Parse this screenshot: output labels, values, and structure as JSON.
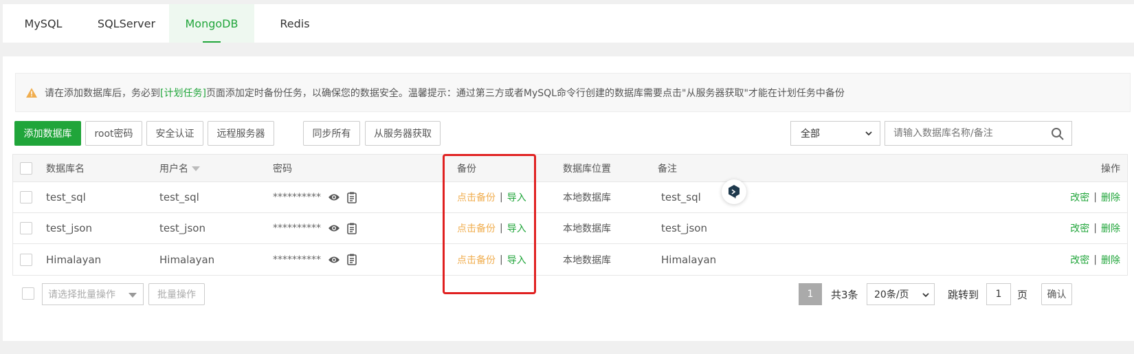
{
  "tabs": [
    {
      "label": "MySQL"
    },
    {
      "label": "SQLServer"
    },
    {
      "label": "MongoDB"
    },
    {
      "label": "Redis"
    }
  ],
  "alert": {
    "text_before": "请在添加数据库后，务必到",
    "link": "[计划任务]",
    "text_after": "页面添加定时备份任务，以确保您的数据安全。温馨提示：通过第三方或者MySQL命令行创建的数据库需要点击\"从服务器获取\"才能在计划任务中备份"
  },
  "toolbar": {
    "add_db": "添加数据库",
    "root_pwd": "root密码",
    "security": "安全认证",
    "remote": "远程服务器",
    "sync_all": "同步所有",
    "fetch_server": "从服务器获取",
    "filter_value": "全部",
    "search_placeholder": "请输入数据库名称/备注"
  },
  "table": {
    "headers": {
      "name": "数据库名",
      "user": "用户名",
      "password": "密码",
      "backup": "备份",
      "location": "数据库位置",
      "note": "备注",
      "ops": "操作"
    },
    "rows": [
      {
        "name": "test_sql",
        "user": "test_sql",
        "password": "**********",
        "backup": "点击备份",
        "import": "导入",
        "location": "本地数据库",
        "note": "test_sql",
        "edit": "改密",
        "delete": "删除"
      },
      {
        "name": "test_json",
        "user": "test_json",
        "password": "**********",
        "backup": "点击备份",
        "import": "导入",
        "location": "本地数据库",
        "note": "test_json",
        "edit": "改密",
        "delete": "删除"
      },
      {
        "name": "Himalayan",
        "user": "Himalayan",
        "password": "**********",
        "backup": "点击备份",
        "import": "导入",
        "location": "本地数据库",
        "note": "Himalayan",
        "edit": "改密",
        "delete": "删除"
      }
    ]
  },
  "footer": {
    "batch_select_placeholder": "请选择批量操作",
    "batch_button": "批量操作",
    "current_page": "1",
    "total": "共3条",
    "page_size": "20条/页",
    "jump_label": "跳转到",
    "jump_value": "1",
    "page_unit": "页",
    "confirm": "确认"
  },
  "colors": {
    "accent": "#20a53a",
    "backup_link": "#f0ad4e",
    "highlight_box": "#e02020"
  }
}
